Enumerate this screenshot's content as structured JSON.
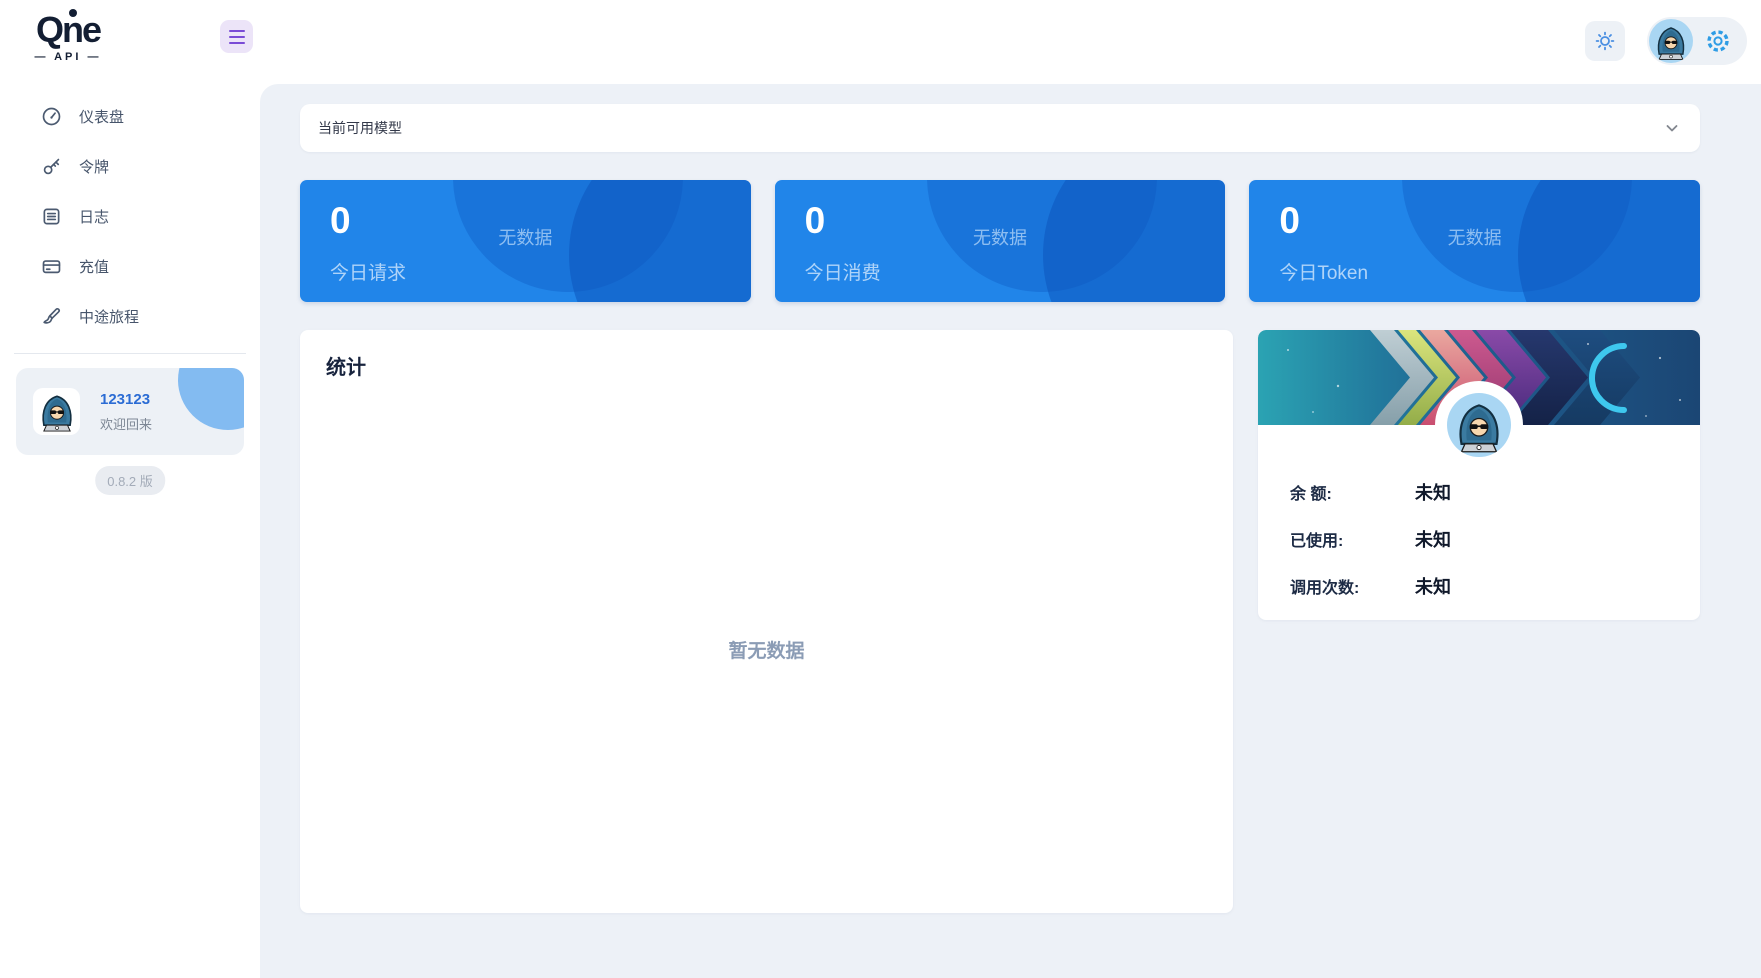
{
  "brand": {
    "name": "Qne",
    "sub": "— API —"
  },
  "header": {
    "hamburger_icon": "menu-icon",
    "theme_icon": "sun-icon",
    "avatar_icon": "hacker-avatar",
    "settings_icon": "gear-icon"
  },
  "sidebar": {
    "items": [
      {
        "label": "仪表盘",
        "icon": "gauge-icon"
      },
      {
        "label": "令牌",
        "icon": "key-icon"
      },
      {
        "label": "日志",
        "icon": "logs-icon"
      },
      {
        "label": "充值",
        "icon": "credit-card-icon"
      },
      {
        "label": "中途旅程",
        "icon": "paintbrush-icon"
      }
    ],
    "user": {
      "name": "123123",
      "greeting": "欢迎回来",
      "avatar": "hacker-avatar"
    },
    "version": "0.8.2 版"
  },
  "main": {
    "models_panel": {
      "label": "当前可用模型",
      "chevron": "chevron-down-icon"
    },
    "stat_cards": [
      {
        "value": "0",
        "label": "今日请求",
        "empty": "无数据"
      },
      {
        "value": "0",
        "label": "今日消费",
        "empty": "无数据"
      },
      {
        "value": "0",
        "label": "今日Token",
        "empty": "无数据"
      }
    ],
    "statistics": {
      "title": "统计",
      "empty_text": "暂无数据"
    },
    "account_card": {
      "rows": [
        {
          "label": "余 额:",
          "value": "未知"
        },
        {
          "label": "已使用:",
          "value": "未知"
        },
        {
          "label": "调用次数:",
          "value": "未知"
        }
      ]
    }
  },
  "colors": {
    "main_bg": "#edf1f7",
    "stat_card_blue": "#2185e9",
    "accent_purple": "#7a4bd6",
    "accent_blue": "#2e9ce5",
    "username_blue": "#2b6cd4"
  }
}
